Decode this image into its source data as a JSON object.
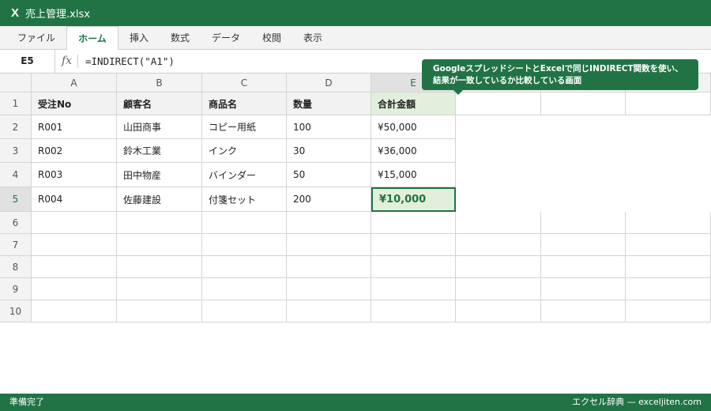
{
  "app": {
    "icon": "excel-x-icon",
    "icon_glyph": "X",
    "title": "売上管理.xlsx",
    "accent_color": "#217346"
  },
  "ribbon": {
    "tabs": [
      {
        "label": "ファイル",
        "active": false
      },
      {
        "label": "ホーム",
        "active": true
      },
      {
        "label": "挿入",
        "active": false
      },
      {
        "label": "数式",
        "active": false
      },
      {
        "label": "データ",
        "active": false
      },
      {
        "label": "校閲",
        "active": false
      },
      {
        "label": "表示",
        "active": false
      }
    ]
  },
  "formula_bar": {
    "name_box": "E5",
    "fx_label": "fx",
    "formula": "=INDIRECT(\"A1\")"
  },
  "callout": {
    "line1": "GoogleスプレッドシートとExcelで同じINDIRECT関数を使い、",
    "line2": "結果が一致しているか比較している画面"
  },
  "sheet": {
    "columns": [
      "A",
      "B",
      "C",
      "D",
      "E",
      "",
      "",
      ""
    ],
    "rows": [
      "1",
      "2",
      "3",
      "4",
      "5",
      "6",
      "7",
      "8",
      "9",
      "10"
    ],
    "active_cell": "E5",
    "cells": [
      [
        "受注No",
        "顧客名",
        "商品名",
        "数量",
        "合計金額"
      ],
      [
        "R001",
        "山田商事",
        "コピー用紙",
        "100",
        "¥50,000"
      ],
      [
        "R002",
        "鈴木工業",
        "インク",
        "30",
        "¥36,000"
      ],
      [
        "R003",
        "田中物産",
        "バインダー",
        "50",
        "¥15,000"
      ],
      [
        "R004",
        "佐藤建設",
        "付箋セット",
        "200",
        "¥10,000"
      ]
    ]
  },
  "status": {
    "left": "準備完了",
    "right": "エクセル辞典 — exceljiten.com"
  }
}
